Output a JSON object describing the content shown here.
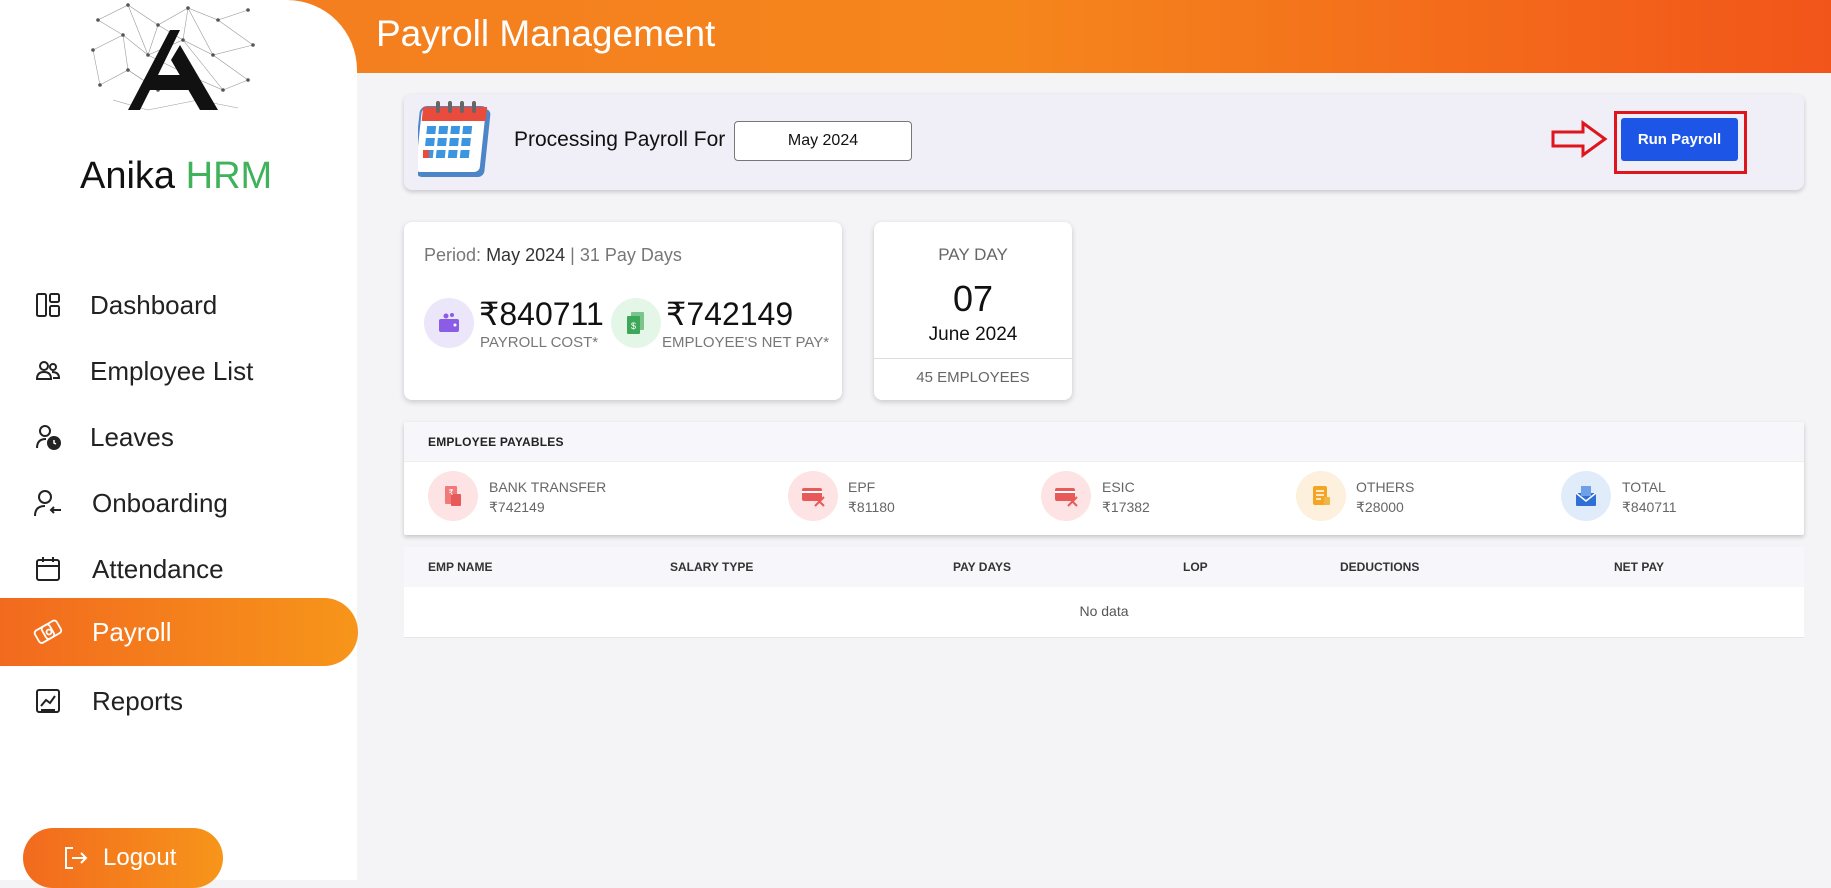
{
  "header": {
    "title": "Payroll Management"
  },
  "brand": {
    "name": "Anika",
    "suffix": "HRM"
  },
  "sidebar": {
    "items": [
      {
        "label": "Dashboard"
      },
      {
        "label": "Employee List"
      },
      {
        "label": "Leaves"
      },
      {
        "label": "Onboarding"
      },
      {
        "label": "Attendance"
      },
      {
        "label": "Payroll",
        "active": true
      },
      {
        "label": "Reports"
      }
    ],
    "logout_label": "Logout"
  },
  "processing": {
    "label": "Processing Payroll For",
    "month": "May 2024",
    "run_label": "Run Payroll"
  },
  "period": {
    "prefix": "Period:",
    "month": "May 2024",
    "separator": "|",
    "pay_days": "31 Pay Days",
    "payroll_cost": "₹840711",
    "payroll_cost_label": "PAYROLL COST*",
    "net_pay": "₹742149",
    "net_pay_label": "EMPLOYEE'S NET PAY*"
  },
  "payday": {
    "title": "PAY DAY",
    "day": "07",
    "month": "June 2024",
    "employees": "45 EMPLOYEES"
  },
  "payables": {
    "title": "EMPLOYEE PAYABLES",
    "items": [
      {
        "name": "BANK TRANSFER",
        "value": "₹742149"
      },
      {
        "name": "EPF",
        "value": "₹81180"
      },
      {
        "name": "ESIC",
        "value": "₹17382"
      },
      {
        "name": "OTHERS",
        "value": "₹28000"
      },
      {
        "name": "TOTAL",
        "value": "₹840711"
      }
    ]
  },
  "table": {
    "columns": [
      "EMP NAME",
      "SALARY TYPE",
      "PAY DAYS",
      "LOP",
      "DEDUCTIONS",
      "NET PAY"
    ],
    "empty_text": "No data"
  },
  "colors": {
    "accent": "#f47b20",
    "primary_button": "#1d55e6",
    "highlight": "#e0141c",
    "brand_green": "#3fb25b"
  }
}
